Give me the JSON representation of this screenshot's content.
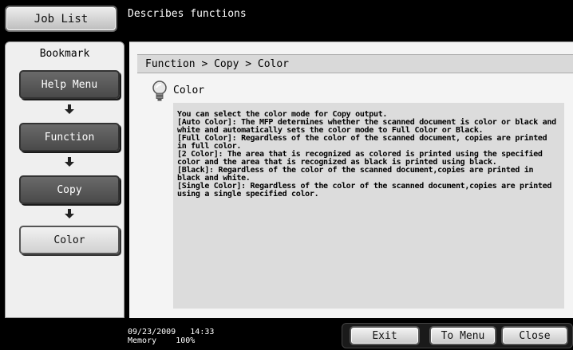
{
  "header": {
    "job_list_label": "Job List",
    "description": "Describes functions"
  },
  "sidebar": {
    "title": "Bookmark",
    "items": [
      {
        "label": "Help Menu",
        "active": false
      },
      {
        "label": "Function",
        "active": false
      },
      {
        "label": "Copy",
        "active": false
      },
      {
        "label": "Color",
        "active": true
      }
    ]
  },
  "main": {
    "breadcrumb": "Function > Copy > Color",
    "topic_title": "Color",
    "topic_icon": "lightbulb-icon",
    "body": "You can select the color mode for Copy output.\n[Auto Color]: The MFP determines whether the scanned document is color or black and white and automatically sets the color mode to Full Color or Black.\n[Full Color]: Regardless of the color of the scanned document, copies are printed in full color.\n[2 Color]: The area that is recognized as colored is printed using the specified color and the area that is recognized as black is printed using black.\n[Black]: Regardless of the color of the scanned document,copies are printed in black and white.\n[Single Color]: Regardless of the color of the scanned document,copies are printed using a single specified color."
  },
  "status": {
    "date": "09/23/2009",
    "time": "14:33",
    "memory_label": "Memory",
    "memory_value": "100%"
  },
  "footer": {
    "exit_label": "Exit",
    "to_menu_label": "To Menu",
    "close_label": "Close"
  }
}
